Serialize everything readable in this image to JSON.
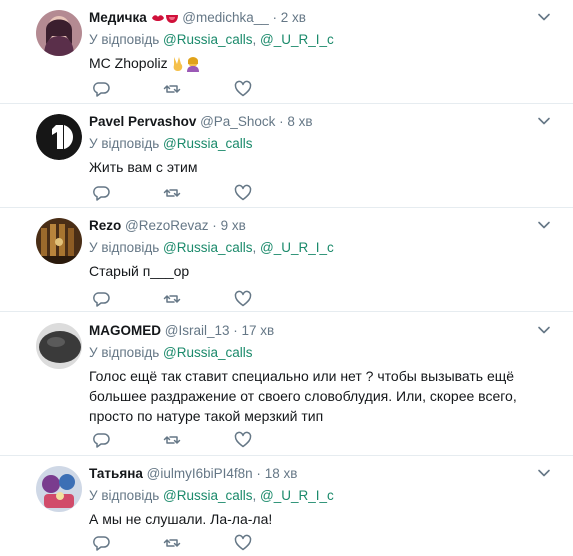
{
  "icons": {
    "reply": "reply-icon",
    "retweet": "retweet-icon",
    "like": "heart-icon",
    "more": "chevron-down-icon"
  },
  "colors": {
    "link": "#1b8a6b",
    "secondary": "#657786",
    "text": "#14171a",
    "divider": "#e6ecf0"
  },
  "tweets": [
    {
      "name": "Медичка",
      "handle": "@medichka__",
      "time": "2 хв",
      "reply_prefix": "У відповідь",
      "reply_to": [
        "@Russia_calls",
        "@_U_R_I_c"
      ],
      "text": "MC Zhopoliz"
    },
    {
      "name": "Pavel Pervashov",
      "handle": "@Pa_Shock",
      "time": "8 хв",
      "reply_prefix": "У відповідь",
      "reply_to": [
        "@Russia_calls"
      ],
      "text": "Жить вам с этим"
    },
    {
      "name": "Rezo",
      "handle": "@RezoRevaz",
      "time": "9 хв",
      "reply_prefix": "У відповідь",
      "reply_to": [
        "@Russia_calls",
        "@_U_R_I_c"
      ],
      "text": "Старый п___ор"
    },
    {
      "name": "MAGOMED",
      "handle": "@Israil_13",
      "time": "17 хв",
      "reply_prefix": "У відповідь",
      "reply_to": [
        "@Russia_calls"
      ],
      "text": "Голос ещё так ставит специально или нет ? чтобы вызывать ещё большее раздражение от своего словоблудия. Или, скорее всего, просто по натуре такой мерзкий тип"
    },
    {
      "name": "Татьяна",
      "handle": "@iulmyI6biPI4f8n",
      "time": "18 хв",
      "reply_prefix": "У відповідь",
      "reply_to": [
        "@Russia_calls",
        "@_U_R_I_c"
      ],
      "text": "А мы не слушали. Ла-ла-ла!"
    }
  ]
}
